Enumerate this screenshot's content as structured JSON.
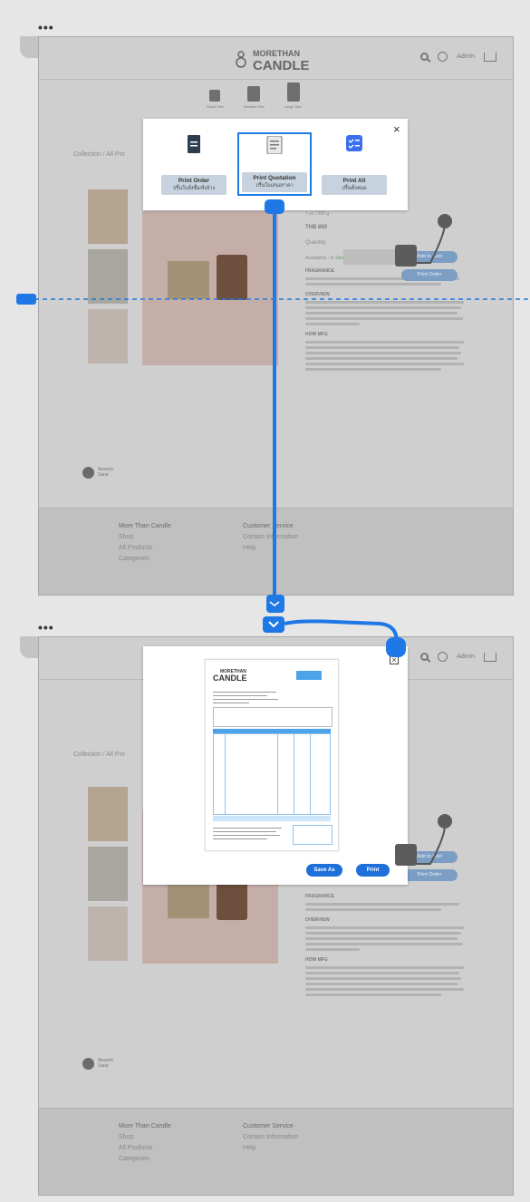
{
  "frames": [
    {
      "dots": "•••"
    },
    {
      "dots": "•••"
    }
  ],
  "header": {
    "brand_top": "MORETHAN",
    "brand_bottom": "CANDLE",
    "user_label": "Admin"
  },
  "categories": [
    "Small Size",
    "Medium Size",
    "Large Size"
  ],
  "breadcrumb": "Collection / All Pro",
  "product": {
    "price": "7 oz / 200 g",
    "price_value": "THB 850",
    "quantity_label": "Quantity",
    "availability_label": "Availability",
    "availability_value": "In Stock",
    "add_to_cart": "Add to Cart",
    "print_order": "Print Order",
    "sections": [
      "FRAGRANCE",
      "OVERVIEW",
      "HOW MFG"
    ]
  },
  "sidebar_user": {
    "name": "Awardo",
    "sub": "Saral"
  },
  "footer": {
    "col1_title": "More Than Candle",
    "col1_items": [
      "Shop",
      "All Products",
      "Categories"
    ],
    "col2_title": "Customer Service",
    "col2_items": [
      "Contact Information",
      "Help"
    ]
  },
  "print_modal": {
    "options": [
      {
        "title": "Print Order",
        "subtitle": "ปริ้นใบสั่งซื้อ/สั่งจ้าง",
        "icon": "document-icon"
      },
      {
        "title": "Print Quotation",
        "subtitle": "ปริ้นใบเสนอราคา",
        "icon": "quotation-icon"
      },
      {
        "title": "Print All",
        "subtitle": "ปริ้นทั้งหมด",
        "icon": "checklist-icon"
      }
    ],
    "close": "×"
  },
  "quotation_modal": {
    "doc_brand_top": "MORETHAN",
    "doc_brand_bottom": "CANDLE",
    "save_label": "Save As",
    "print_label": "Print",
    "close": "×"
  },
  "colors": {
    "accent": "#1e78e6",
    "frame_bg": "#cfcfcf",
    "footer_bg": "#c0c0c0",
    "pill": "#7c9ec4"
  }
}
